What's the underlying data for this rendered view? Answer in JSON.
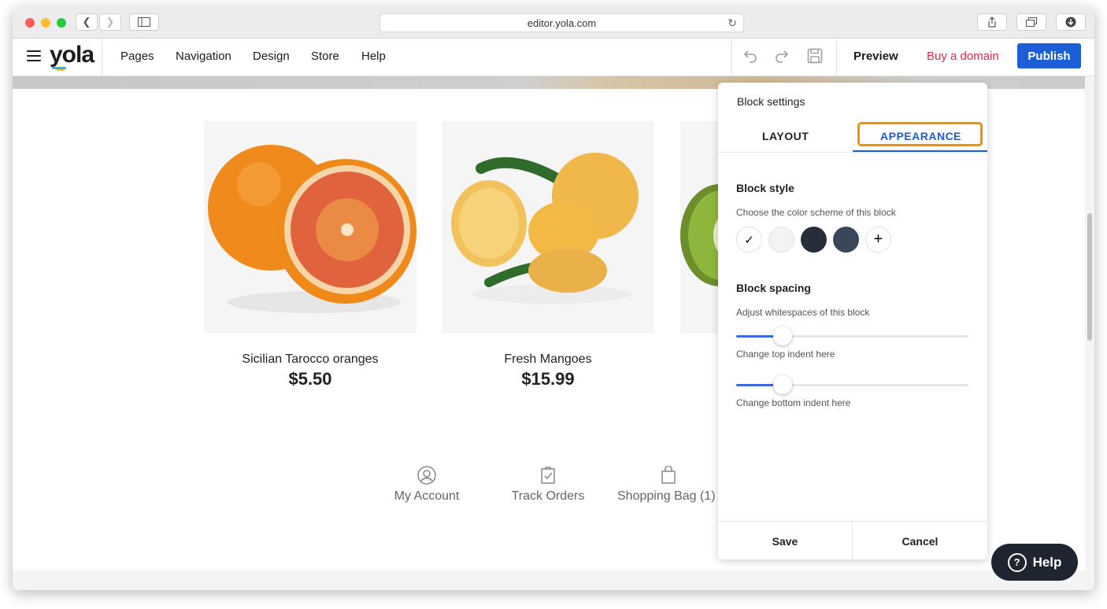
{
  "browser": {
    "url": "editor.yola.com"
  },
  "app": {
    "logo": "yola",
    "nav": [
      "Pages",
      "Navigation",
      "Design",
      "Store",
      "Help"
    ],
    "preview_label": "Preview",
    "buy_domain_label": "Buy a domain",
    "publish_label": "Publish",
    "colors": {
      "publish": "#1c5ed6",
      "buy_domain": "#e0294a"
    }
  },
  "products": [
    {
      "name": "Sicilian Tarocco oranges",
      "price": "$5.50"
    },
    {
      "name": "Fresh Mangoes",
      "price": "$15.99"
    }
  ],
  "footer_links": [
    {
      "label": "My Account",
      "icon": "account-icon"
    },
    {
      "label": "Track Orders",
      "icon": "orders-icon"
    },
    {
      "label": "Shopping Bag (1)",
      "icon": "bag-icon"
    }
  ],
  "panel": {
    "title": "Block settings",
    "tabs": [
      "LAYOUT",
      "APPEARANCE"
    ],
    "active_tab": "APPEARANCE",
    "block_style": {
      "title": "Block style",
      "description": "Choose the color scheme of this block",
      "swatches": [
        "#ffffff",
        "#f3f3f3",
        "#262d3b",
        "#3a4758"
      ],
      "selected_swatch": 0
    },
    "block_spacing": {
      "title": "Block spacing",
      "description": "Adjust whitespaces of this block",
      "top_label": "Change top indent here",
      "bottom_label": "Change bottom indent here",
      "top_value": 0.2,
      "bottom_value": 0.2
    },
    "save_label": "Save",
    "cancel_label": "Cancel"
  },
  "help_label": "Help"
}
